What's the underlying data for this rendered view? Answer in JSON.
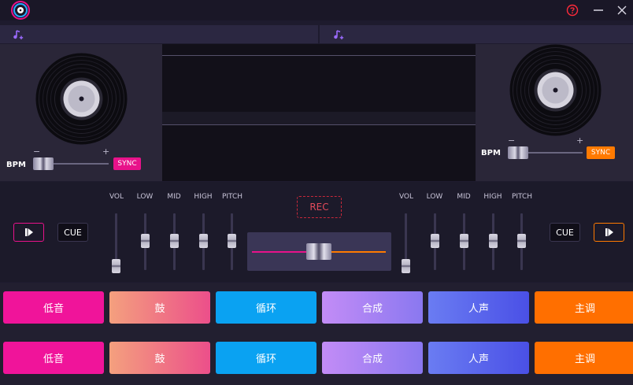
{
  "window": {
    "logo_icon": "vinyl-logo-icon",
    "help_icon": "help-circle-icon",
    "minimize_icon": "minimize-icon",
    "close_icon": "close-icon"
  },
  "deck_left": {
    "add_music_icon": "music-add-icon",
    "bpm_label": "BPM",
    "minus": "−",
    "plus": "+",
    "sync_label": "SYNC",
    "accent": "#e8128a"
  },
  "deck_right": {
    "add_music_icon": "music-add-icon",
    "bpm_label": "BPM",
    "minus": "−",
    "plus": "+",
    "sync_label": "SYNC",
    "accent": "#ff7a00"
  },
  "mixer": {
    "left_eq_labels": [
      "VOL",
      "LOW",
      "MID",
      "HIGH",
      "PITCH"
    ],
    "right_eq_labels": [
      "VOL",
      "LOW",
      "MID",
      "HIGH",
      "PITCH"
    ],
    "rec_label": "REC",
    "cue_left": "CUE",
    "cue_right": "CUE",
    "play_icon": "play-pause-icon"
  },
  "pads": {
    "row1": [
      "低音",
      "鼓",
      "循环",
      "合成",
      "人声",
      "主调"
    ],
    "row2": [
      "低音",
      "鼓",
      "循环",
      "合成",
      "人声",
      "主调"
    ],
    "colors": [
      "#f0149a",
      "gradient-salmon-pink",
      "#0aa2f2",
      "gradient-lavender",
      "gradient-blue",
      "#ff6f00"
    ]
  }
}
